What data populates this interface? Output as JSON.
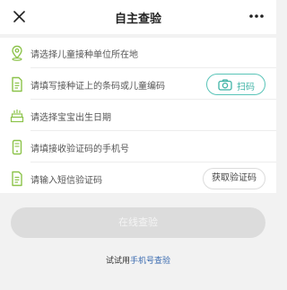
{
  "header": {
    "title": "自主查验",
    "close_icon": "close-icon",
    "more_icon": "more-icon"
  },
  "form": {
    "fields": [
      {
        "icon": "location-pin-icon",
        "placeholder": "请选择儿童接种单位所在地"
      },
      {
        "icon": "document-icon",
        "placeholder": "请填写接种证上的条码或儿童编码",
        "action_label": "扫码",
        "action_icon": "camera-icon"
      },
      {
        "icon": "birthday-cake-icon",
        "placeholder": "请选择宝宝出生日期"
      },
      {
        "icon": "mobile-phone-icon",
        "placeholder": "请填接收验证码的手机号"
      },
      {
        "icon": "document-icon",
        "placeholder": "请输入短信验证码",
        "action_label": "获取验证码"
      }
    ]
  },
  "submit": {
    "label": "在线查验"
  },
  "footer": {
    "prefix": "试试用",
    "link": "手机号查验"
  },
  "colors": {
    "accent_icon": "#8cc34a",
    "scan_accent": "#3fb3a6",
    "link": "#3a6bb0",
    "disabled_button": "#dcdcdc"
  }
}
